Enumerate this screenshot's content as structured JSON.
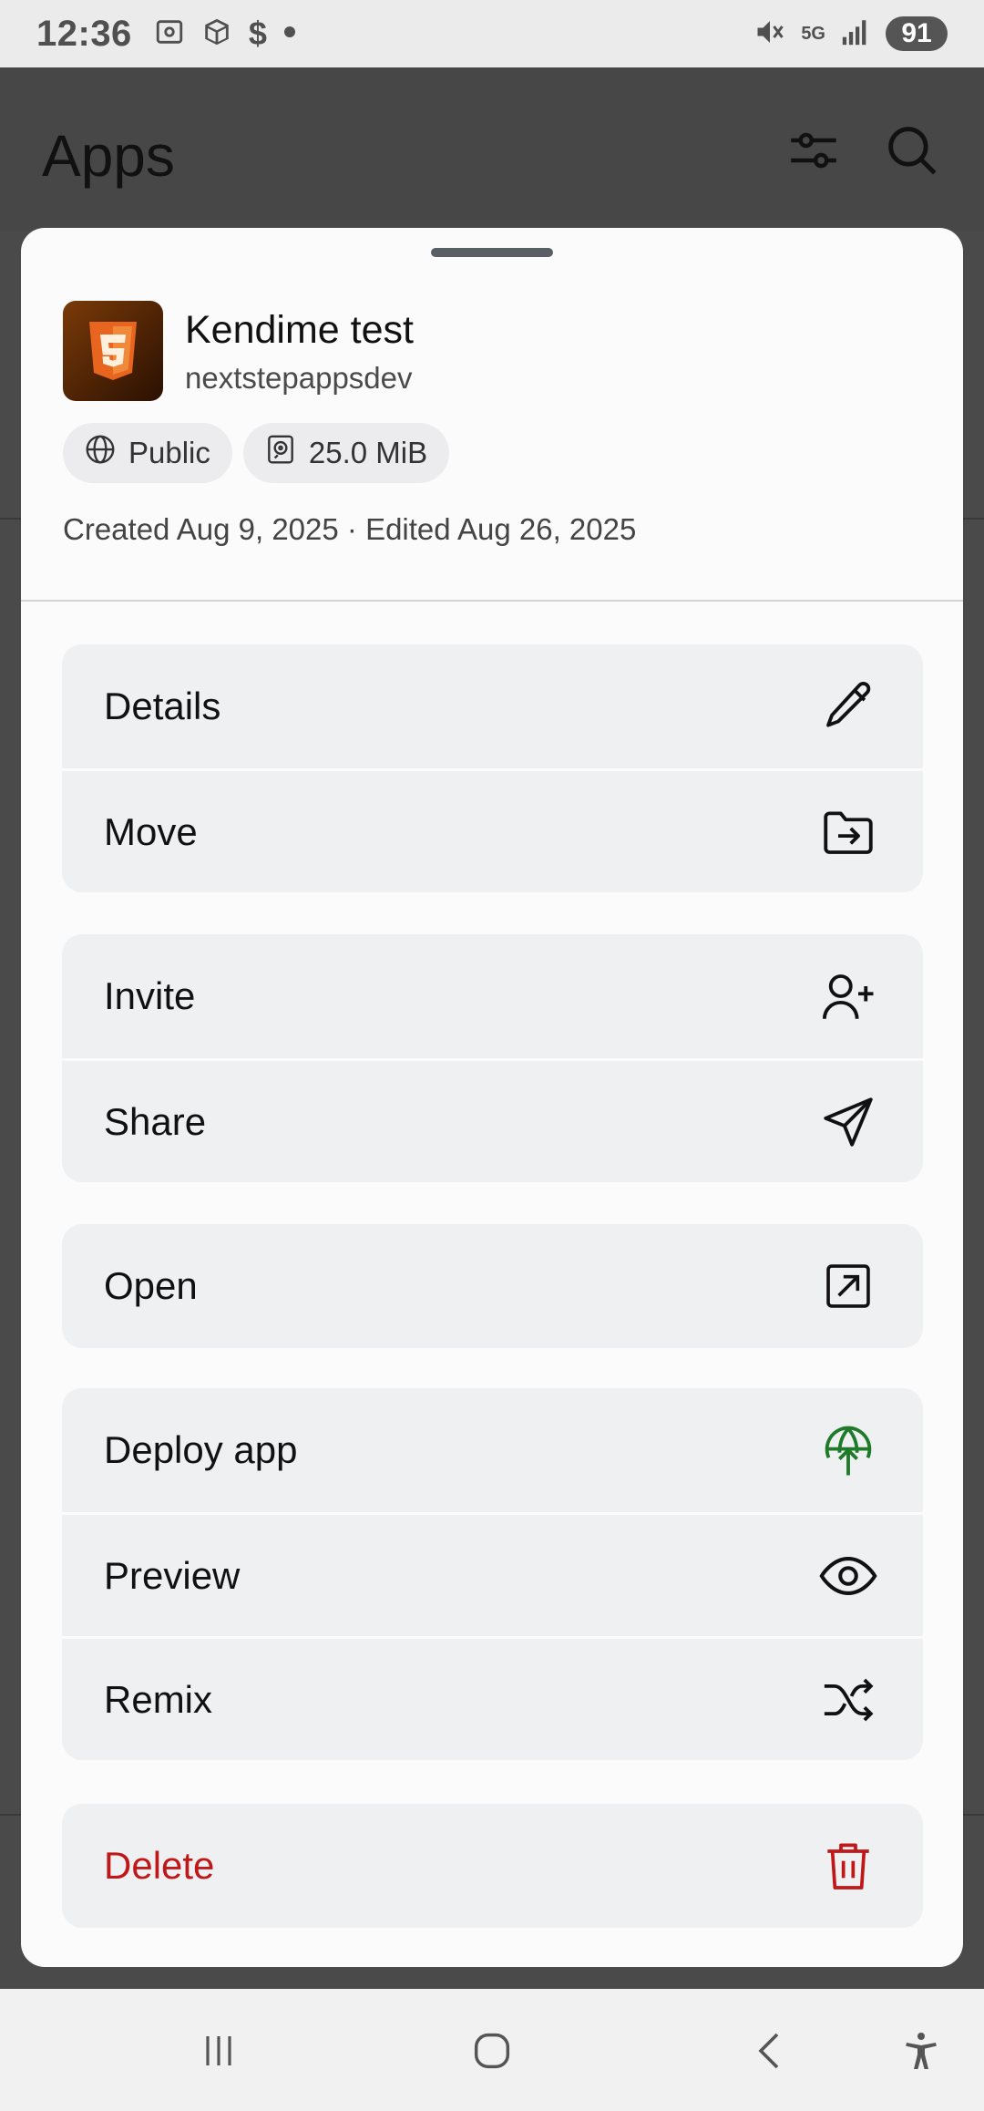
{
  "status_bar": {
    "time": "12:36",
    "network": "5G",
    "battery": "91",
    "icons": [
      "screenshot-icon",
      "package-icon",
      "dollar-icon",
      "dot-icon",
      "mute-icon",
      "signal-icon"
    ]
  },
  "app_header": {
    "title": "Apps",
    "icons": [
      "filter-icon",
      "search-icon"
    ]
  },
  "sheet": {
    "app": {
      "name": "Kendime test",
      "owner": "nextstepappsdev",
      "icon": "html5-icon"
    },
    "chips": {
      "visibility": "Public",
      "size": "25.0 MiB"
    },
    "dates": "Created Aug 9, 2025 · Edited Aug 26, 2025",
    "groups": [
      {
        "items": [
          {
            "label": "Details",
            "icon": "pencil-icon"
          },
          {
            "label": "Move",
            "icon": "folder-move-icon"
          }
        ]
      },
      {
        "items": [
          {
            "label": "Invite",
            "icon": "user-plus-icon"
          },
          {
            "label": "Share",
            "icon": "send-icon"
          }
        ]
      },
      {
        "items": [
          {
            "label": "Open",
            "icon": "external-link-icon"
          }
        ]
      },
      {
        "items": [
          {
            "label": "Deploy app",
            "icon": "globe-upload-icon"
          },
          {
            "label": "Preview",
            "icon": "eye-icon"
          },
          {
            "label": "Remix",
            "icon": "shuffle-icon"
          }
        ]
      },
      {
        "items": [
          {
            "label": "Delete",
            "icon": "trash-icon"
          }
        ]
      }
    ]
  },
  "colors": {
    "danger": "#c01818",
    "deploy_green": "#1f7a2a",
    "sheet_bg": "#fbfbfb",
    "row_bg": "#eff0f2",
    "scrim": "#4a4a4a"
  },
  "nav_bar": {
    "buttons": [
      "recent-apps-icon",
      "home-icon",
      "back-icon",
      "accessibility-icon"
    ]
  }
}
